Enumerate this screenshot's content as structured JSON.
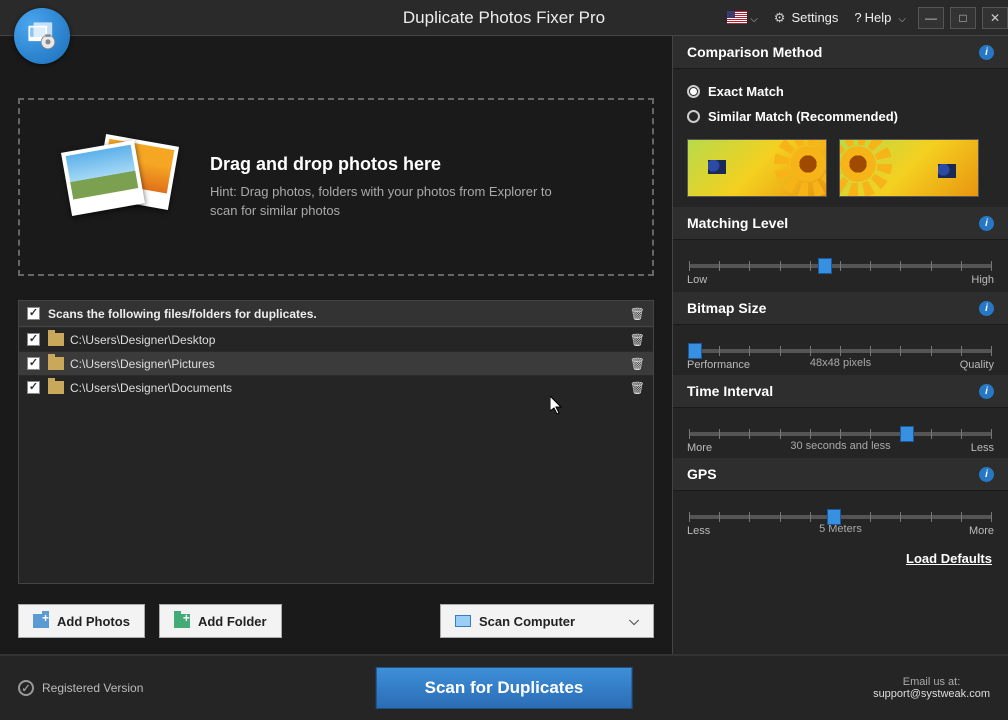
{
  "app": {
    "title": "Duplicate Photos Fixer Pro"
  },
  "titlebar": {
    "settings": "Settings",
    "help": "Help"
  },
  "dropzone": {
    "heading": "Drag and drop photos here",
    "hint": "Hint: Drag photos, folders with your photos from Explorer to scan for similar photos"
  },
  "list": {
    "header": "Scans the following files/folders for duplicates.",
    "items": [
      {
        "path": "C:\\Users\\Designer\\Desktop",
        "checked": true,
        "hovered": false
      },
      {
        "path": "C:\\Users\\Designer\\Pictures",
        "checked": true,
        "hovered": true
      },
      {
        "path": "C:\\Users\\Designer\\Documents",
        "checked": true,
        "hovered": false
      }
    ]
  },
  "buttons": {
    "add_photos": "Add Photos",
    "add_folder": "Add Folder",
    "scan_computer": "Scan Computer",
    "scan_duplicates": "Scan for Duplicates"
  },
  "footer": {
    "registered": "Registered Version",
    "email_label": "Email us at:",
    "email": "support@systweak.com"
  },
  "sidebar": {
    "comparison": {
      "title": "Comparison Method",
      "exact": "Exact Match",
      "similar": "Similar Match (Recommended)",
      "selected": "exact"
    },
    "matching": {
      "title": "Matching Level",
      "low": "Low",
      "high": "High",
      "pos_pct": 45
    },
    "bitmap": {
      "title": "Bitmap Size",
      "left": "Performance",
      "right": "Quality",
      "center": "48x48 pixels",
      "pos_pct": 2
    },
    "time": {
      "title": "Time Interval",
      "left": "More",
      "right": "Less",
      "center": "30 seconds and less",
      "pos_pct": 72
    },
    "gps": {
      "title": "GPS",
      "left": "Less",
      "right": "More",
      "center": "5 Meters",
      "pos_pct": 48
    },
    "load_defaults": "Load Defaults"
  }
}
